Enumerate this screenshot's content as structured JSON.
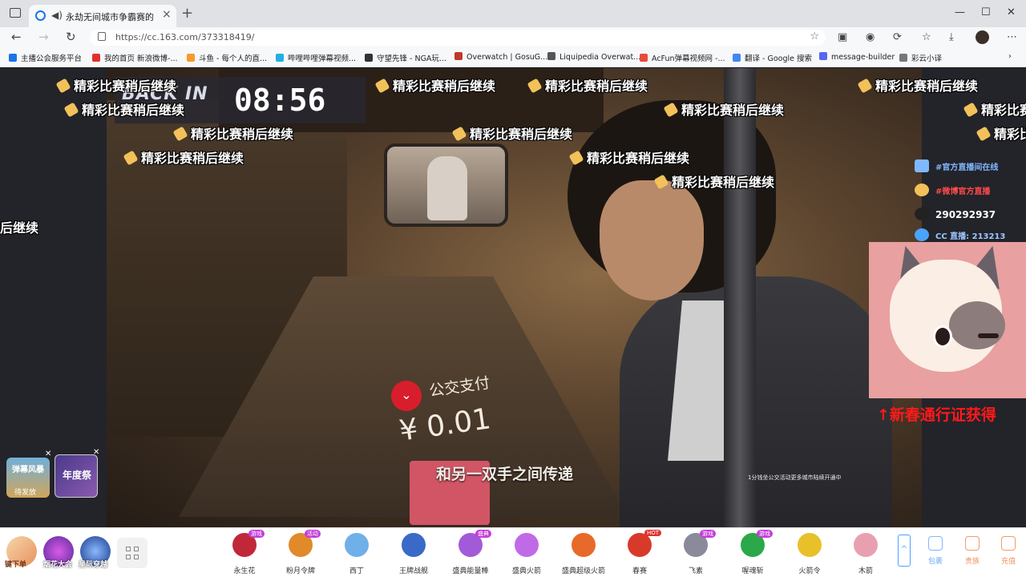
{
  "browser": {
    "tab_title": "永劫无间城市争霸赛的永劫",
    "new_tab": "+",
    "url": "https://cc.163.com/373318419/",
    "window_controls": {
      "minimize": "—",
      "maximize": "☐",
      "close": "✕"
    },
    "bookmarks": [
      {
        "label": "主播公会服务平台",
        "color": "#1a73e8"
      },
      {
        "label": "我的首页 新浪微博-...",
        "color": "#e0312f"
      },
      {
        "label": "斗鱼 - 每个人的直...",
        "color": "#f59b2a"
      },
      {
        "label": "哔哩哔哩弹幕视频...",
        "color": "#23ade5"
      },
      {
        "label": "守望先锋 - NGA玩...",
        "color": "#333"
      },
      {
        "label": "Overwatch | GosuG...",
        "color": "#c0392b"
      },
      {
        "label": "Liquipedia Overwat...",
        "color": "#555"
      },
      {
        "label": "AcFun弹幕视频网 -...",
        "color": "#e74c3c"
      },
      {
        "label": "翻译 - Google 搜索",
        "color": "#4285f4"
      },
      {
        "label": "message-builder",
        "color": "#5865f2"
      },
      {
        "label": "彩云小译",
        "color": "#777"
      }
    ]
  },
  "stream": {
    "back_in": "BACK IN",
    "timer": "08:56",
    "danmu_text": "精彩比赛稍后继续",
    "left_banner": "后继续",
    "pay_label": "公交支付",
    "pay_amount": "¥ 0.01",
    "subtitle": "和另一双手之间传递",
    "small_text": "1分钱坐公交活动更多城市陆续开通中"
  },
  "info": {
    "row1": "#官方直播间在线",
    "row2": "#微博官方直播",
    "qq_group": "290292937",
    "cc_room": "CC 直播: 213213"
  },
  "promo": "↑新春通行证获得",
  "badges": {
    "badge1_title": "弹幕风暴",
    "badge1_sub": "待发放",
    "badge2_title": "年度祭"
  },
  "bottom": {
    "left_apps": [
      "键下单",
      "烟花大会",
      "星际穿越"
    ],
    "gifts": [
      {
        "label": "永生花",
        "tag": "游戏",
        "tag_color": "#c33cd8",
        "color": "#c0283a"
      },
      {
        "label": "粉月令牌",
        "tag": "活动",
        "tag_color": "#c33cd8",
        "color": "#e08a2a"
      },
      {
        "label": "西丁",
        "tag": "",
        "tag_color": "",
        "color": "#6fb0e8"
      },
      {
        "label": "王牌战舰",
        "tag": "",
        "tag_color": "",
        "color": "#3a6ac8"
      },
      {
        "label": "盛典能量棒",
        "tag": "盛典",
        "tag_color": "#c33cd8",
        "color": "#a35ad8"
      },
      {
        "label": "盛典火箭",
        "tag": "",
        "tag_color": "",
        "color": "#c06ae8"
      },
      {
        "label": "盛典超级火箭",
        "tag": "",
        "tag_color": "",
        "color": "#e86a2a"
      },
      {
        "label": "春赛",
        "tag": "HOT",
        "tag_color": "#e0312f",
        "color": "#d83a2a"
      },
      {
        "label": "飞素",
        "tag": "游戏",
        "tag_color": "#c33cd8",
        "color": "#8a8a9a"
      },
      {
        "label": "喔魂斩",
        "tag": "游戏",
        "tag_color": "#c33cd8",
        "color": "#2aa84a"
      },
      {
        "label": "火箭令",
        "tag": "",
        "tag_color": "",
        "color": "#e8c02a"
      },
      {
        "label": "木箭",
        "tag": "",
        "tag_color": "",
        "color": "#e8a0b0"
      }
    ],
    "right_buttons": [
      "包裹",
      "贵族",
      "充值"
    ],
    "scroll_up": "^"
  }
}
